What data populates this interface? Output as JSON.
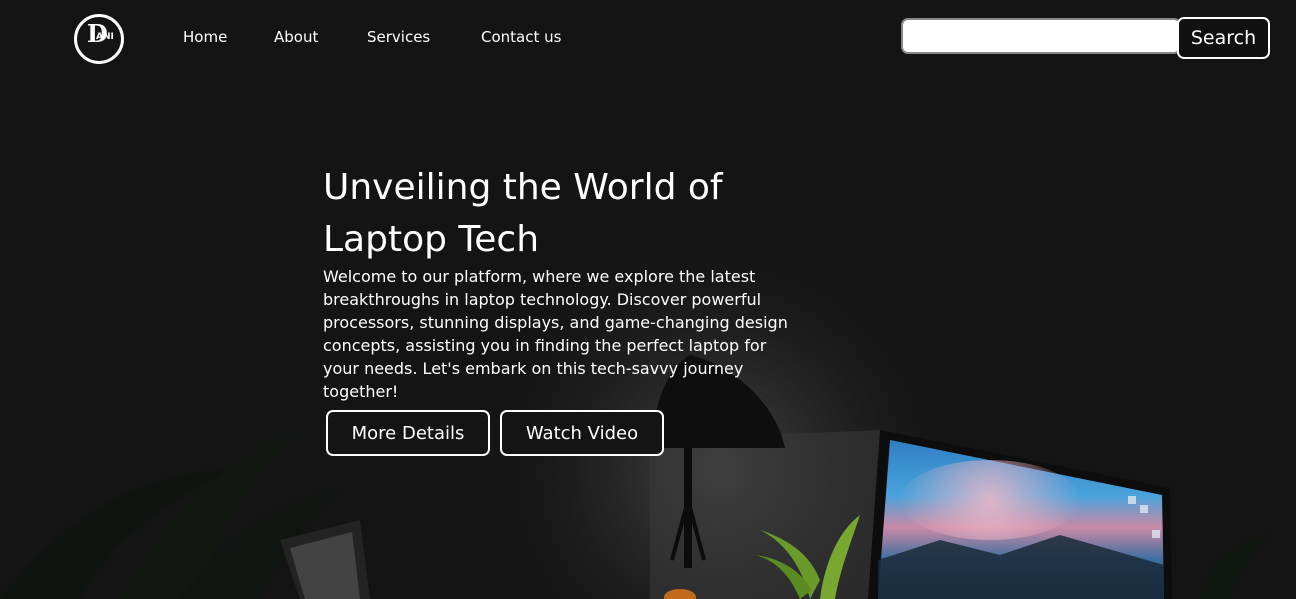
{
  "logo": {
    "initial": "D",
    "suffix": "ANI"
  },
  "nav": {
    "items": [
      {
        "label": "Home"
      },
      {
        "label": "About"
      },
      {
        "label": "Services"
      },
      {
        "label": "Contact us"
      }
    ]
  },
  "search": {
    "placeholder": "",
    "value": "",
    "button_label": "Search"
  },
  "hero": {
    "title": "Unveiling the World of Laptop Tech",
    "description": "Welcome to our platform, where we explore the latest breakthroughs in laptop technology. Discover powerful processors, stunning displays, and game-changing design concepts, assisting you in finding the perfect laptop for your needs. Let's embark on this tech-savvy journey together!",
    "buttons": [
      {
        "label": "More Details"
      },
      {
        "label": "Watch Video"
      }
    ]
  },
  "colors": {
    "background": "#141414",
    "text": "#ffffff",
    "top_strip": "#0b0f1c",
    "screen_sky": "#3b8fd0"
  }
}
